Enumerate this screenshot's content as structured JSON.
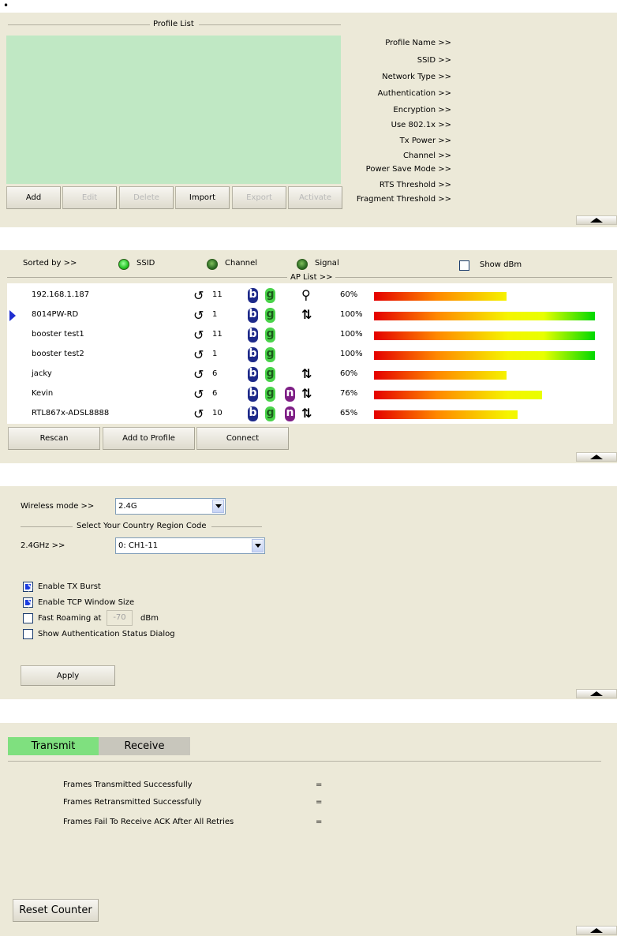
{
  "bullet": "•",
  "profile": {
    "group_title": "Profile List",
    "buttons": [
      "Add",
      "Edit",
      "Delete",
      "Import",
      "Export",
      "Activate"
    ],
    "fields": [
      "Profile Name >>",
      "SSID >>",
      "Network Type >>",
      "Authentication >>",
      "Encryption >>",
      "Use 802.1x >>",
      "Tx Power >>",
      "Channel >>",
      "Power Save Mode >>",
      "RTS Threshold >>",
      "Fragment Threshold >>"
    ],
    "colors": {
      "list_bg": "#c0e8c4"
    }
  },
  "aplist": {
    "sorted_by": "Sorted by >>",
    "sort_options": [
      "SSID",
      "Channel",
      "Signal"
    ],
    "show_dbm": "Show dBm",
    "group_title": "AP List >>",
    "rows": [
      {
        "ssid": "192.168.1.187",
        "channel": "11",
        "b": true,
        "g": true,
        "n": false,
        "security": "key-icon",
        "signal": "60%",
        "signal_value": 0.6,
        "selected": false
      },
      {
        "ssid": "8014PW-RD",
        "channel": "1",
        "b": true,
        "g": true,
        "n": false,
        "security": "refresh-icon",
        "signal": "100%",
        "signal_value": 1.0,
        "selected": true
      },
      {
        "ssid": "booster test1",
        "channel": "11",
        "b": true,
        "g": true,
        "n": false,
        "security": "",
        "signal": "100%",
        "signal_value": 1.0,
        "selected": false
      },
      {
        "ssid": "booster test2",
        "channel": "1",
        "b": true,
        "g": true,
        "n": false,
        "security": "",
        "signal": "100%",
        "signal_value": 1.0,
        "selected": false
      },
      {
        "ssid": "jacky",
        "channel": "6",
        "b": true,
        "g": true,
        "n": false,
        "security": "refresh-icon",
        "signal": "60%",
        "signal_value": 0.6,
        "selected": false
      },
      {
        "ssid": "Kevin",
        "channel": "6",
        "b": true,
        "g": true,
        "n": true,
        "security": "refresh-icon",
        "signal": "76%",
        "signal_value": 0.76,
        "selected": false
      },
      {
        "ssid": "RTL867x-ADSL8888",
        "channel": "10",
        "b": true,
        "g": true,
        "n": true,
        "security": "refresh-icon",
        "signal": "65%",
        "signal_value": 0.65,
        "selected": false
      }
    ],
    "buttons": [
      "Rescan",
      "Add to Profile",
      "Connect"
    ],
    "badge_letters": {
      "b": "b",
      "g": "g",
      "n": "n"
    }
  },
  "advanced": {
    "wireless_mode_label": "Wireless mode >>",
    "wireless_mode_value": "2.4G",
    "region_group_title": "Select Your Country Region Code",
    "band_label": "2.4GHz >>",
    "band_value": "0: CH1-11",
    "enable_tx_burst": "Enable TX Burst",
    "enable_tcp_window": "Enable TCP Window Size",
    "fast_roaming": "Fast Roaming at",
    "fast_roaming_value": "-70",
    "dbm_unit": "dBm",
    "show_auth_dialog": "Show Authentication Status Dialog",
    "apply": "Apply",
    "checks": {
      "tx_burst": true,
      "tcp_window": true,
      "fast_roaming": false,
      "auth_dialog": false
    }
  },
  "statistics": {
    "tab_transmit": "Transmit",
    "tab_receive": "Receive",
    "rows": [
      "Frames Transmitted Successfully",
      "Frames Retransmitted Successfully",
      "Frames Fail To Receive ACK After All Retries"
    ],
    "equals": "=",
    "reset": "Reset Counter",
    "colors": {
      "active_tab": "#7fe07f",
      "inactive_tab": "#c8c6bc"
    }
  }
}
